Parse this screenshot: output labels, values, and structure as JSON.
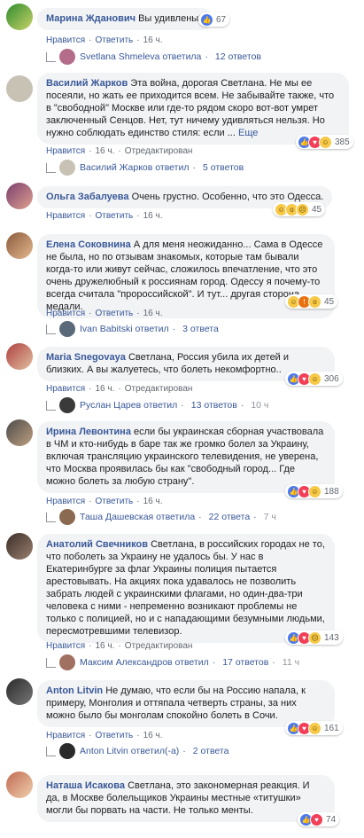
{
  "actions": {
    "like": "Нравится",
    "reply_word": "Ответить",
    "edited": "Отредактирован",
    "sep": "·"
  },
  "comments": [
    {
      "author": "Марина Жданович",
      "text": "Вы удивлены?",
      "time": "16 ч.",
      "react_count": "67",
      "reply": {
        "text": "Svetlana Shmeleva ответила",
        "count": "12 ответов",
        "time": ""
      }
    },
    {
      "author": "Василий Жарков",
      "text": "Эта война, дорогая Светлана. Не мы ее посеяли, но жать ее приходится всем. Не забывайте также, что в \"свободной\" Москве или где-то рядом скоро вот-вот умрет заключенный Сенцов. Нет, тут ничему удивляться нельзя. Но нужно соблюдать единство стиля: если ...",
      "more": "Еще",
      "time": "16 ч.",
      "react_count": "385",
      "edited": true,
      "reply": {
        "text": "Василий Жарков ответил",
        "count": "5 ответов",
        "time": ""
      }
    },
    {
      "author": "Ольга Забалуева",
      "text": "Очень грустно. Особенно, что это Одесса.",
      "time": "16 ч.",
      "react_count": "45"
    },
    {
      "author": "Елена Соковнина",
      "text": "А для меня неожиданно... Сама в Одессе не была, но по отзывам знакомых, которые там бывали когда-то или живут сейчас, сложилось впечатление, что это очень дружелюбный к россиянам город. Одессу я почему-то всегда считала \"пророссийской\". И тут... другая сторона медали.",
      "time": "16 ч.",
      "react_count": "45",
      "reply": {
        "text": "Ivan Babitski ответил",
        "count": "3 ответа",
        "time": ""
      }
    },
    {
      "author": "Maria Snegovaya",
      "text": "Светлана, Россия убила их детей и близких. А вы жалуетесь, что болеть некомфортно..",
      "time": "16 ч.",
      "react_count": "306",
      "edited": true,
      "reply": {
        "text": "Руслан Царев ответил",
        "count": "13 ответов",
        "time": "10 ч"
      }
    },
    {
      "author": "Ирина Левонтина",
      "text": "если бы украинская сборная участвовала в ЧМ и кто-нибудь в баре так же громко болел за Украину, включая трансляцию украинского телевидения, не уверена, что Москва проявилась бы как \"свободный город... Где можно болеть за любую страну\".",
      "time": "16 ч.",
      "react_count": "188",
      "reply": {
        "text": "Таша Дашевская ответила",
        "count": "22 ответа",
        "time": "7 ч"
      }
    },
    {
      "author": "Анатолий Свечников",
      "text": "Светлана, в российских городах не то, что поболеть за Украину не удалось бы. У нас в Екатеринбурге за флаг Украины полиция пытается арестовывать. На акциях пока удавалось не позволить забрать людей с украинскими флагами, но один-два-три человека с ними - непременно возникают проблемы не только с полицией, но и с нападающими безумными людьми, пересмотревшими телевизор.",
      "time": "16 ч.",
      "react_count": "143",
      "edited": true,
      "reply": {
        "text": "Максим Александров ответил",
        "count": "17 ответов",
        "time": "11 ч"
      }
    },
    {
      "author": "Anton Litvin",
      "text": "Не думаю, что если бы на Россию напала, к примеру, Монголия и оттяпала четверть страны, за них можно было бы монголам спокойно болеть в Сочи.",
      "time": "16 ч.",
      "react_count": "161",
      "reply": {
        "text": "Anton Litvin ответил(-а)",
        "count": "2 ответа",
        "time": ""
      }
    },
    {
      "author": "Наташа Исакова",
      "text": "Светлана, это закономерная реакция. И да, в Москве болельщиков Украины местные «титушки» могли бы порвать на части. Не только менты.",
      "time": "",
      "react_count": "74"
    }
  ],
  "colors": {
    "link": "#385898",
    "bubble": "#f2f3f5",
    "meta": "#606770"
  }
}
